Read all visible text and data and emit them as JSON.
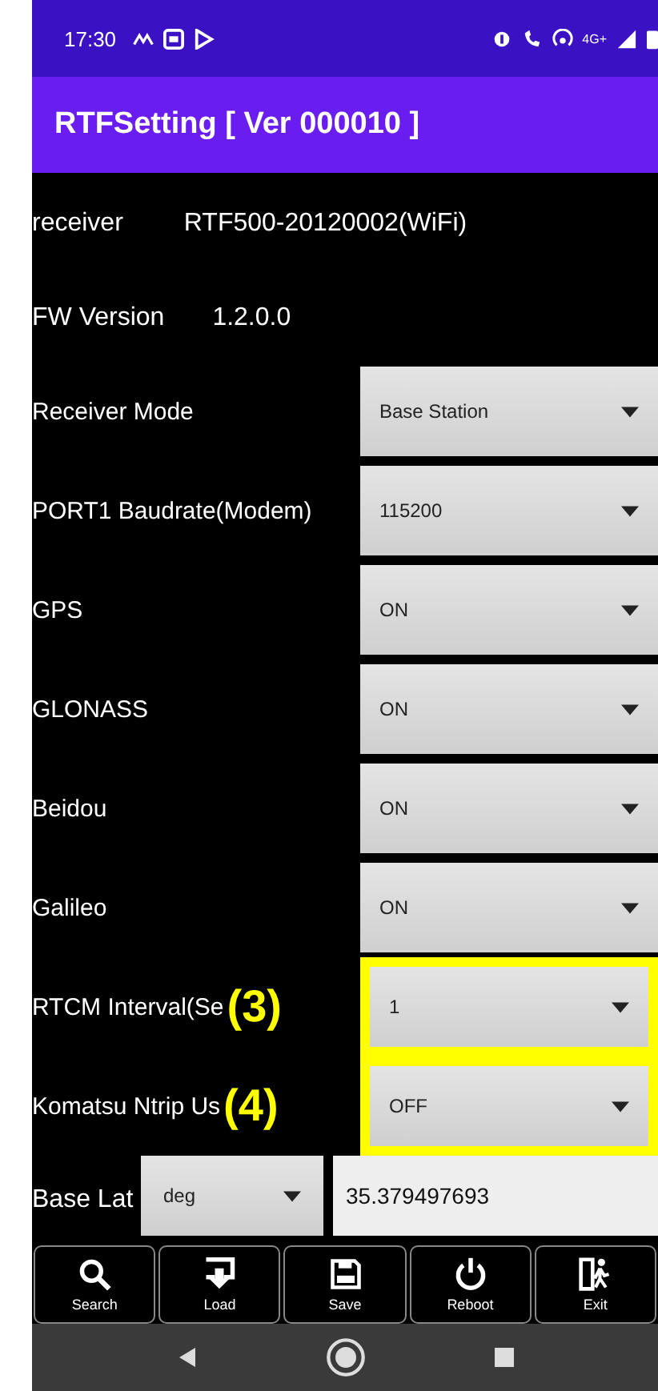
{
  "status_bar": {
    "time": "17:30",
    "network": "4G+"
  },
  "app_bar": {
    "title": "RTFSetting [ Ver 000010 ]"
  },
  "rows": [
    {
      "kind": "info",
      "label": "receiver",
      "value": "RTF500-20120002(WiFi)"
    },
    {
      "kind": "info",
      "label": "FW Version",
      "value": "1.2.0.0"
    },
    {
      "kind": "dropdown",
      "label": "Receiver Mode",
      "value": "Base Station",
      "highlighted": false
    },
    {
      "kind": "dropdown",
      "label": "PORT1 Baudrate(Modem)",
      "value": "115200",
      "highlighted": false
    },
    {
      "kind": "dropdown",
      "label": "GPS",
      "value": "ON",
      "highlighted": false
    },
    {
      "kind": "dropdown",
      "label": "GLONASS",
      "value": "ON",
      "highlighted": false
    },
    {
      "kind": "dropdown",
      "label": "Beidou",
      "value": "ON",
      "highlighted": false
    },
    {
      "kind": "dropdown",
      "label": "Galileo",
      "value": "ON",
      "highlighted": false
    },
    {
      "kind": "dropdown",
      "label": "RTCM Interval(Se",
      "value": "1",
      "highlighted": true,
      "annotation": "(3)"
    },
    {
      "kind": "dropdown",
      "label": "Komatsu Ntrip Us",
      "value": "OFF",
      "highlighted": true,
      "annotation": "(4)"
    },
    {
      "kind": "coordinate",
      "label": "Base Lat",
      "unit": "deg",
      "value": "35.379497693"
    }
  ],
  "toolbar": [
    {
      "kind": "search",
      "label": "Search"
    },
    {
      "kind": "load",
      "label": "Load"
    },
    {
      "kind": "save",
      "label": "Save"
    },
    {
      "kind": "power",
      "label": "Reboot"
    },
    {
      "kind": "exit",
      "label": "Exit"
    }
  ]
}
